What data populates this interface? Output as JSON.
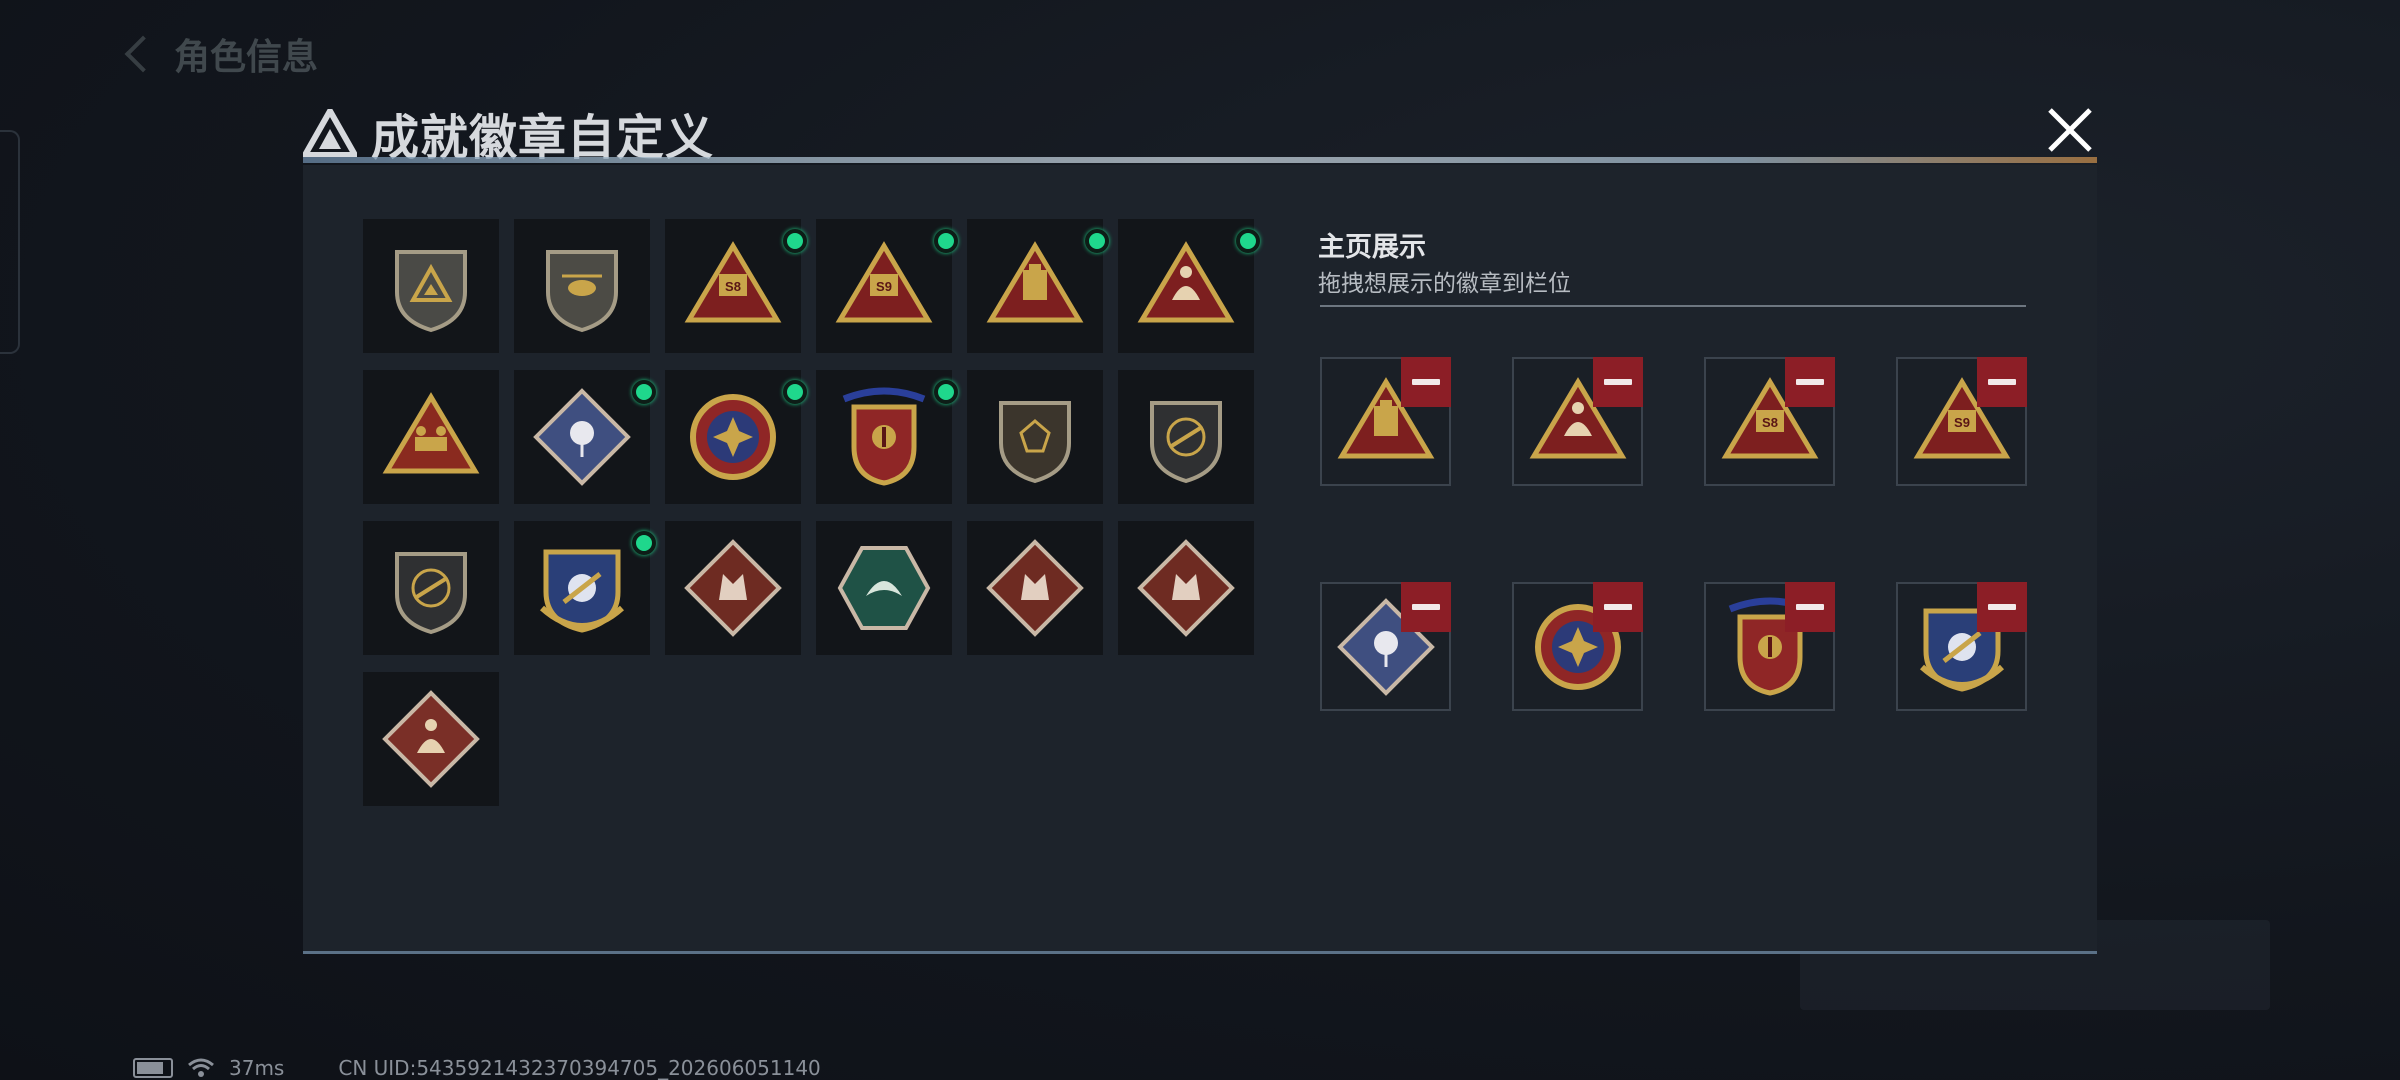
{
  "modal": {
    "title": "成就徽章自定义",
    "close_icon": "close-icon"
  },
  "background": {
    "back_title": "角色信息"
  },
  "owned_badges": [
    {
      "name": "gray-triangle-shield-badge",
      "shape": "shield",
      "base": "#4a4a46",
      "motif": "triangle",
      "new": false
    },
    {
      "name": "helicopter-shield-badge",
      "shape": "shield",
      "base": "#4c4b45",
      "motif": "heli",
      "new": false
    },
    {
      "name": "s8-red-triangle-badge",
      "shape": "triangle",
      "base": "#7d1f1f",
      "motif": "S8",
      "new": true
    },
    {
      "name": "s9-winged-triangle-badge",
      "shape": "triangle",
      "base": "#7d1f1f",
      "motif": "S9",
      "new": true
    },
    {
      "name": "gold-box-triangle-badge",
      "shape": "triangle",
      "base": "#7d1f1f",
      "motif": "box",
      "new": true
    },
    {
      "name": "sitting-figure-triangle-badge",
      "shape": "triangle",
      "base": "#7d1f1f",
      "motif": "figure",
      "new": true
    },
    {
      "name": "squad-triangle-badge",
      "shape": "triangle",
      "base": "#8a2a1f",
      "motif": "squad",
      "new": false
    },
    {
      "name": "rose-diamond-badge",
      "shape": "diamond",
      "base": "#3f4f80",
      "motif": "rose",
      "new": true
    },
    {
      "name": "star-medal-badge",
      "shape": "round",
      "base": "#8f2626",
      "motif": "star",
      "new": true
    },
    {
      "name": "eagle-crest-badge",
      "shape": "crest",
      "base": "#8f2626",
      "motif": "crest",
      "new": true
    },
    {
      "name": "skull-shield-badge",
      "shape": "shield",
      "base": "#3b352c",
      "motif": "skull",
      "new": false
    },
    {
      "name": "rifle-shield-badge",
      "shape": "shield",
      "base": "#2f3032",
      "motif": "rifle",
      "new": false
    },
    {
      "name": "rifle-shield-badge-2",
      "shape": "shield",
      "base": "#2f3032",
      "motif": "rifle",
      "new": false
    },
    {
      "name": "navy-laurel-shield-badge",
      "shape": "laurel",
      "base": "#2a3f78",
      "motif": "sword",
      "new": true
    },
    {
      "name": "wolf-diamond-badge",
      "shape": "diamond",
      "base": "#6e2b22",
      "motif": "wolf",
      "new": false
    },
    {
      "name": "green-hexagon-badge",
      "shape": "hexagon",
      "base": "#1f5246",
      "motif": "wing",
      "new": false
    },
    {
      "name": "dragon-diamond-badge",
      "shape": "diamond",
      "base": "#6e2b22",
      "motif": "dragon",
      "new": false
    },
    {
      "name": "dragon-diamond-badge-2",
      "shape": "diamond",
      "base": "#6e2b22",
      "motif": "dragon",
      "new": false
    },
    {
      "name": "runner-diamond-badge",
      "shape": "diamond",
      "base": "#7a2f27",
      "motif": "runner",
      "new": false
    }
  ],
  "showcase": {
    "title": "主页展示",
    "subtitle": "拖拽想展示的徽章到栏位",
    "slots": [
      {
        "name": "showcase-box-triangle",
        "shape": "triangle",
        "base": "#7d1f1f",
        "motif": "box"
      },
      {
        "name": "showcase-figure-triangle",
        "shape": "triangle",
        "base": "#7d1f1f",
        "motif": "figure"
      },
      {
        "name": "showcase-s8-triangle",
        "shape": "triangle",
        "base": "#7d1f1f",
        "motif": "S8"
      },
      {
        "name": "showcase-s9-triangle",
        "shape": "triangle",
        "base": "#7d1f1f",
        "motif": "S9"
      },
      {
        "name": "showcase-rose-diamond",
        "shape": "diamond",
        "base": "#3f4f80",
        "motif": "rose"
      },
      {
        "name": "showcase-star-medal",
        "shape": "round",
        "base": "#8f2626",
        "motif": "star"
      },
      {
        "name": "showcase-eagle-crest",
        "shape": "crest",
        "base": "#8f2626",
        "motif": "crest"
      },
      {
        "name": "showcase-navy-laurel",
        "shape": "laurel",
        "base": "#2a3f78",
        "motif": "sword"
      }
    ]
  },
  "status_bar": {
    "ping": "37ms",
    "uid": "CN UID:5435921432370394705_202606051140"
  },
  "colors": {
    "gold": "#c9a54a",
    "new_dot": "#1fd78c",
    "remove": "#8c1e26"
  }
}
